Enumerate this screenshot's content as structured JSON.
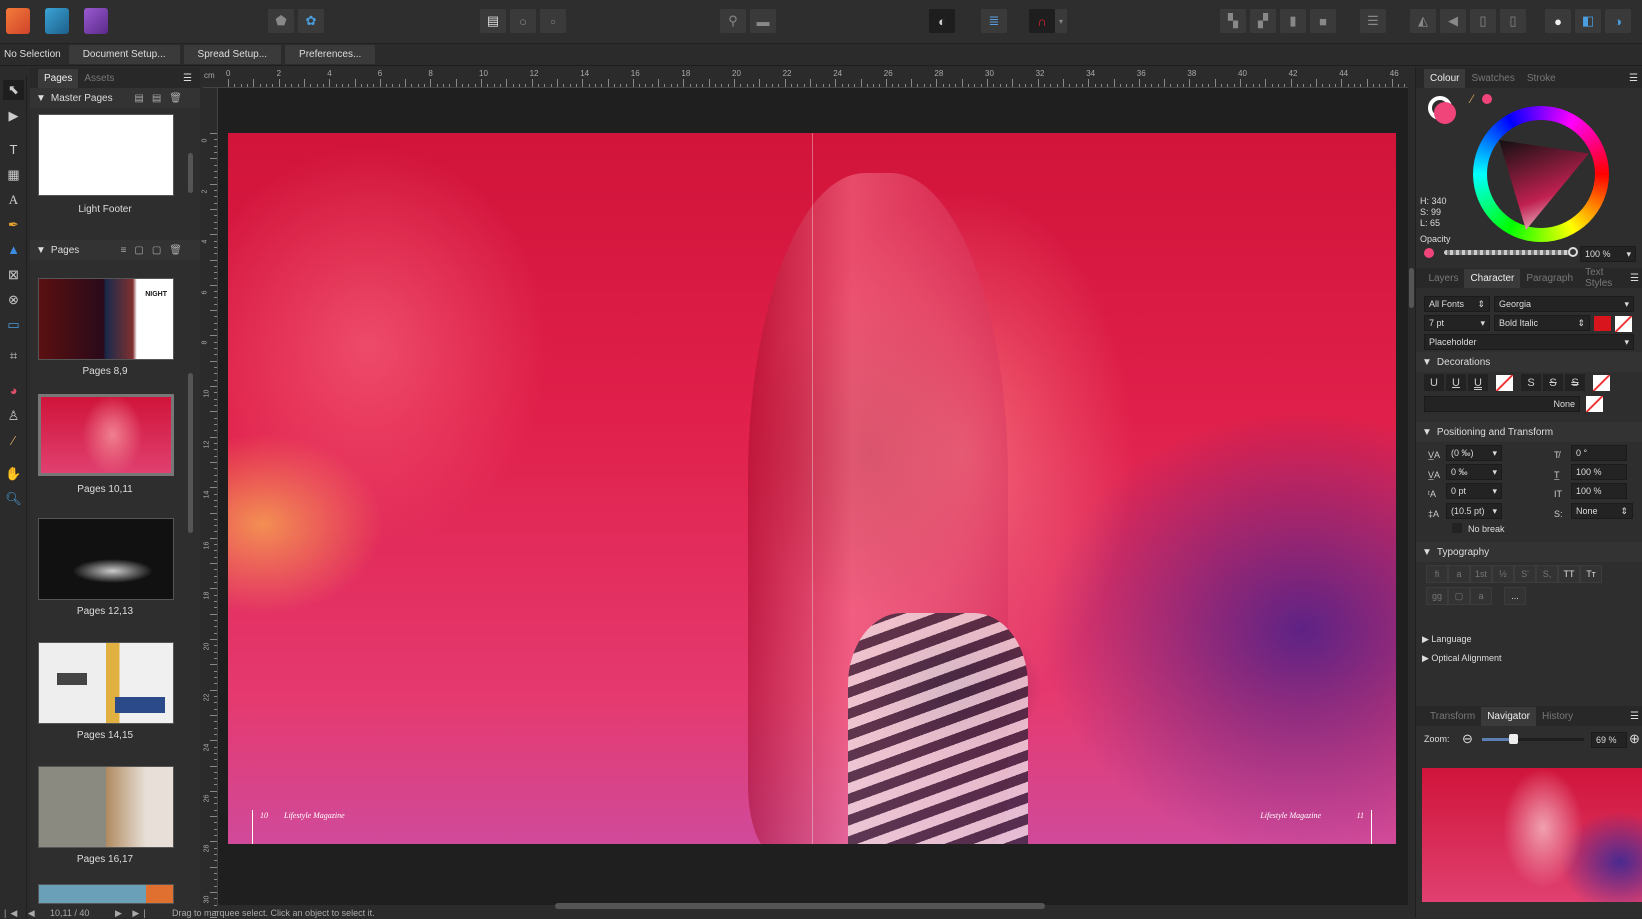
{
  "topbar": {
    "apps": [
      {
        "name": "publisher",
        "color": "#e8602c"
      },
      {
        "name": "designer",
        "color": "#2b84b6"
      },
      {
        "name": "photo",
        "color": "#7c3ea8"
      }
    ]
  },
  "context": {
    "selection": "No Selection",
    "buttons": [
      "Document Setup...",
      "Spread Setup...",
      "Preferences..."
    ]
  },
  "pages_panel": {
    "tabs": [
      "Pages",
      "Assets"
    ],
    "master_header": "Master Pages",
    "master_pages": [
      {
        "label": "Light Footer"
      }
    ],
    "pages_header": "Pages",
    "pages": [
      {
        "label": "Pages 8,9"
      },
      {
        "label": "Pages 10,11",
        "selected": true
      },
      {
        "label": "Pages 12,13"
      },
      {
        "label": "Pages 14,15"
      },
      {
        "label": "Pages 16,17"
      }
    ],
    "thumb_night_text": "NIGHT"
  },
  "ruler": {
    "unit": "cm",
    "h_labels": [
      "0",
      "2",
      "4",
      "6",
      "8",
      "10",
      "12",
      "14",
      "16",
      "18",
      "20",
      "22",
      "24",
      "26",
      "28",
      "30",
      "32",
      "34",
      "36",
      "38",
      "40",
      "42",
      "44",
      "46"
    ],
    "v_labels": [
      "0",
      "2",
      "4",
      "6",
      "8",
      "10",
      "12",
      "14",
      "16",
      "18",
      "20",
      "22",
      "24",
      "26",
      "28",
      "30"
    ]
  },
  "spread": {
    "left_page_number": "10",
    "left_footer": "Lifestyle Magazine",
    "right_footer": "Lifestyle Magazine",
    "right_page_number": "11"
  },
  "colour_panel": {
    "tabs": [
      "Colour",
      "Swatches",
      "Stroke"
    ],
    "h": "H: 340",
    "s": "S: 99",
    "l": "L: 65",
    "opacity_label": "Opacity",
    "opacity_value": "100 %",
    "current_color": "#f0457a"
  },
  "character_panel": {
    "tabs": [
      "Layers",
      "Character",
      "Paragraph",
      "Text Styles"
    ],
    "font_collection": "All Fonts",
    "font": "Georgia",
    "size": "7 pt",
    "style": "Bold Italic",
    "text_color": "#d8141c",
    "style_select": "Placeholder"
  },
  "decorations": {
    "header": "Decorations",
    "underline_buttons": [
      "U",
      "U",
      "U"
    ],
    "strike_buttons": [
      "S",
      "S",
      "S"
    ],
    "line_value": "None"
  },
  "positioning": {
    "header": "Positioning and Transform",
    "tracking": "(0 ‰)",
    "kerning": "0 ‰",
    "baseline": "0 pt",
    "leading": "(10.5 pt)",
    "shear": "0 °",
    "vscale": "100 %",
    "hscale": "100 %",
    "superscript": "None",
    "no_break": "No break"
  },
  "typography": {
    "header": "Typography",
    "buttons": [
      "fi",
      "a",
      "1st",
      "½",
      "S'",
      "S,",
      "TT",
      "Tт"
    ],
    "row2": [
      "gg",
      "▢",
      "a",
      "..."
    ]
  },
  "collapsed": [
    "Language",
    "Optical Alignment"
  ],
  "navigator": {
    "tabs": [
      "Transform",
      "Navigator",
      "History"
    ],
    "zoom_label": "Zoom:",
    "zoom_value": "69 %",
    "zoom_fraction": 0.3
  },
  "status": {
    "page_counter": "10,11 / 40",
    "hint": "Drag to marquee select. Click an object to select it."
  }
}
